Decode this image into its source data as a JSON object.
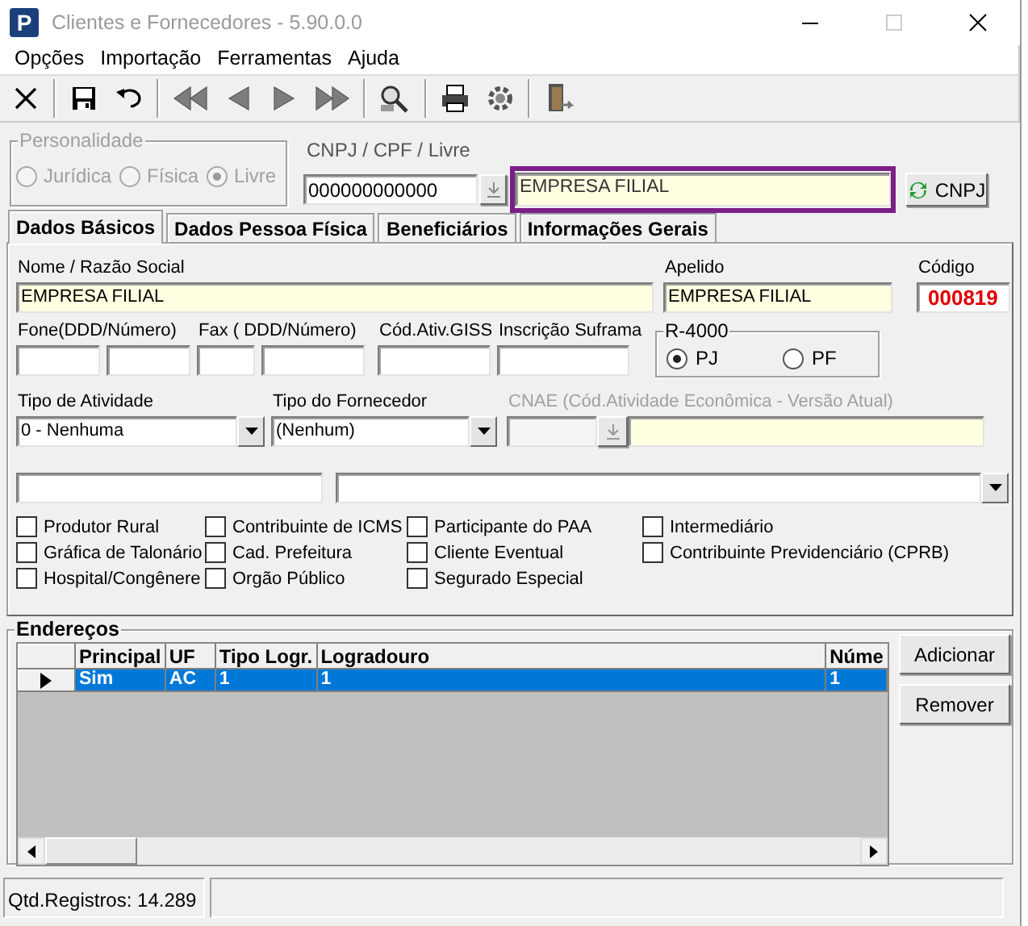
{
  "window": {
    "title": "Clientes e Fornecedores - 5.90.0.0",
    "icon_letter": "P"
  },
  "menu": [
    "Opções",
    "Importação",
    "Ferramentas",
    "Ajuda"
  ],
  "toolbar": [
    {
      "kind": "cancel"
    },
    {
      "kind": "sep"
    },
    {
      "kind": "save"
    },
    {
      "kind": "undo"
    },
    {
      "kind": "sep"
    },
    {
      "kind": "first"
    },
    {
      "kind": "prev"
    },
    {
      "kind": "next"
    },
    {
      "kind": "last"
    },
    {
      "kind": "sep"
    },
    {
      "kind": "search"
    },
    {
      "kind": "sep"
    },
    {
      "kind": "print"
    },
    {
      "kind": "tools"
    },
    {
      "kind": "sep"
    },
    {
      "kind": "exit"
    }
  ],
  "personalidade": {
    "label": "Personalidade",
    "disabled": true,
    "options": [
      {
        "label": "Jurídica",
        "selected": false
      },
      {
        "label": "Física",
        "selected": false
      },
      {
        "label": "Livre",
        "selected": true
      }
    ]
  },
  "document": {
    "label": "CNPJ / CPF / Livre",
    "value": "000000000000",
    "name_value": "EMPRESA FILIAL",
    "highlighted": true
  },
  "cnpj_button": "CNPJ",
  "tabs": [
    {
      "label": "Dados Básicos",
      "selected": true
    },
    {
      "label": "Dados Pessoa Física",
      "selected": false
    },
    {
      "label": "Beneficiários",
      "selected": false
    },
    {
      "label": "Informações Gerais",
      "selected": false
    }
  ],
  "nome": {
    "label": "Nome / Razão Social",
    "value": "EMPRESA FILIAL"
  },
  "apelido": {
    "label": "Apelido",
    "value": "EMPRESA FILIAL"
  },
  "codigo": {
    "label": "Código",
    "value": "000819"
  },
  "contact_labels": [
    "Fone(DDD/Número)",
    "Fax ( DDD/Número)",
    "Cód.Ativ.GISS",
    "Inscrição Suframa"
  ],
  "r4000": {
    "label": "R-4000",
    "options": [
      {
        "label": "PJ",
        "selected": true
      },
      {
        "label": "PF",
        "selected": false
      }
    ]
  },
  "tipo_atividade": {
    "label": "Tipo de Atividade",
    "value": "0 - Nenhuma"
  },
  "tipo_fornecedor": {
    "label": "Tipo do Fornecedor",
    "value": "(Nenhum)"
  },
  "cnae": {
    "label": "CNAE (Cód.Atividade Econômica - Versão Atual)",
    "disabled": true
  },
  "checkbox_columns": [
    {
      "items": [
        {
          "label": "Produtor Rural",
          "checked": false
        },
        {
          "label": "Gráfica de Talonário",
          "checked": false
        },
        {
          "label": "Hospital/Congênere",
          "checked": false
        }
      ]
    },
    {
      "items": [
        {
          "label": "Contribuinte de ICMS",
          "checked": false
        },
        {
          "label": "Cad. Prefeitura",
          "checked": false
        },
        {
          "label": "Orgão Público",
          "checked": false
        }
      ]
    },
    {
      "items": [
        {
          "label": "Participante do PAA",
          "checked": false
        },
        {
          "label": "Cliente Eventual",
          "checked": false
        },
        {
          "label": "Segurado Especial",
          "checked": false
        }
      ]
    },
    {
      "items": [
        {
          "label": "Intermediário",
          "checked": false
        },
        {
          "label": "Contribuinte Previdenciário (CPRB)",
          "checked": false
        }
      ]
    }
  ],
  "enderecos": {
    "title": "Endereços",
    "columns": [
      "Principal",
      "UF",
      "Tipo Logr.",
      "Logradouro",
      "Núme"
    ],
    "rows": [
      {
        "cells": [
          "Sim",
          "AC",
          "1",
          "1",
          "1"
        ],
        "selected": true
      }
    ],
    "buttons": [
      "Adicionar",
      "Remover"
    ]
  },
  "status_bar": [
    "Qtd.Registros: 14.289"
  ]
}
